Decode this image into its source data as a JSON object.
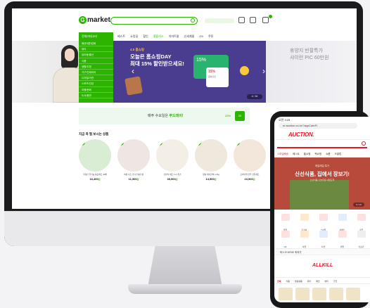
{
  "gmarket": {
    "logo": "market",
    "logo_mark": "G",
    "promo_chip": "",
    "nav_category": "전체카테고리",
    "nav_items": [
      "베스트",
      "쇼킹딜",
      "할인",
      "홈플러스",
      "이마트몰",
      "신세계몰",
      "G9",
      "쿠폰"
    ],
    "category_menu": [
      "패션의류/잡화",
      "뷰티",
      "유아동/출산",
      "식품",
      "생활/주방",
      "가구/인테리어",
      "디지털/가전",
      "스포츠/건강",
      "여행/문화",
      "도서/음반"
    ],
    "hero": {
      "tag": "4.5 홈쇼핑",
      "title_line1": "오늘은 홈쇼핑DAY",
      "title_line2": "최대 15% 할인받으세요!",
      "card_percent": "15%",
      "coupon_percent": "15%",
      "coupon_label": "중복할인",
      "pager": "4 / 16",
      "right_text_line1": "휴양지 반팔특가",
      "right_text_line2": "샤이런 PIC 60만원"
    },
    "banner": {
      "prefix": "매주 수요일은 ",
      "highlight": "푸드데이!",
      "percent": "20%",
      "badge": "20"
    },
    "section_title": "지금 꼭 필 보시는 상품",
    "products": [
      {
        "badge": "1",
        "name": "국내산 유기농 음료세트 30팩",
        "price": "16,400",
        "unit": "원",
        "color": "#d9ecd4"
      },
      {
        "badge": "2",
        "name": "여성 니트 가디건 봄신상",
        "price": "11,900",
        "unit": "원",
        "color": "#efe6e3"
      },
      {
        "badge": "3",
        "name": "간편식 세트 1+1 특가",
        "price": "39,900",
        "unit": "원",
        "color": "#f4efe6"
      },
      {
        "badge": "4",
        "name": "양념 돼지갈비 1.2kg",
        "price": "14,500",
        "unit": "원",
        "color": "#efe8dc"
      },
      {
        "badge": "5",
        "name": "프리미엄 한우 선물세트",
        "price": "23,900",
        "unit": "원",
        "color": "#f3e6da"
      }
    ]
  },
  "auction": {
    "status_time": "오전 3:25",
    "url": "m.auction.co.kr/?appCateFr",
    "logo": "AUCTION.",
    "tabs": [
      "스마일배송",
      "베스트",
      "홈쇼핑",
      "핵쇼핑",
      "쇼룸",
      "오클럽"
    ],
    "hero": {
      "sub": "매일매일 특가",
      "title": "신선식품, 집에서 장보기!",
      "desc": "신선식품 오늘주문 내일도착",
      "pager": "3 / 12"
    },
    "quick_menu": [
      "올킬",
      "홈쇼핑",
      "스마일",
      "이벤트",
      "쿠폰",
      "G9",
      "여행",
      "티켓",
      "렌탈",
      "더보기"
    ],
    "notice": "마스크 MT4E 최저가",
    "allkill_logo": "ALLKILL",
    "subtabs": [
      "전체",
      "식품",
      "생활용품",
      "유아",
      "패션",
      "뷰티",
      "가전"
    ]
  }
}
